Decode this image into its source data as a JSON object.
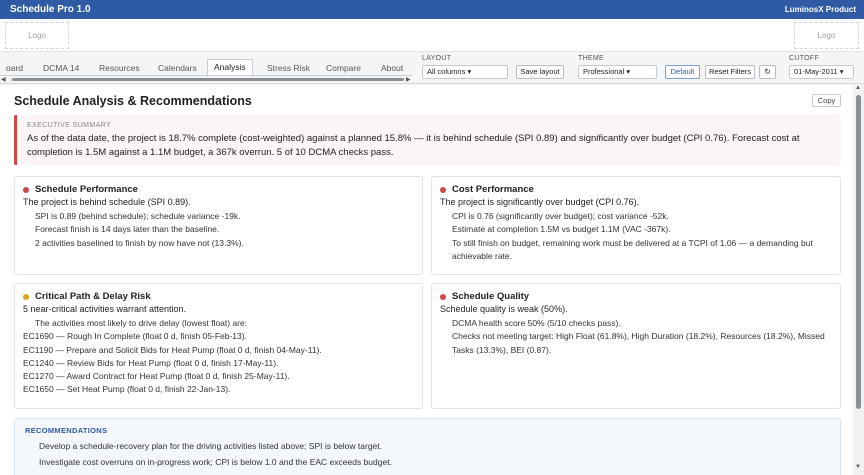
{
  "app": {
    "title": "Schedule Pro 1.0",
    "brand": "LuminosX Product"
  },
  "logos": {
    "left": "Logo",
    "right": "Logo"
  },
  "tabs": [
    {
      "label": "oard"
    },
    {
      "label": "DCMA 14"
    },
    {
      "label": "Resources"
    },
    {
      "label": "Calendars"
    },
    {
      "label": "Analysis",
      "active": true
    },
    {
      "label": "Stress Risk"
    },
    {
      "label": "Compare"
    },
    {
      "label": "About"
    }
  ],
  "controls": {
    "layout_label": "LAYOUT",
    "layout_value": "All columns",
    "save_layout": "Save layout",
    "theme_label": "THEME",
    "theme_value": "Professional",
    "default_btn": "Default",
    "reset_filters": "Reset Filters",
    "refresh_icon": "↻",
    "cutoff_label": "CUTOFF",
    "cutoff_value": "01-May-2011"
  },
  "page": {
    "title": "Schedule Analysis & Recommendations",
    "copy": "Copy"
  },
  "executive": {
    "label": "EXECUTIVE SUMMARY",
    "text": "As of the data date, the project is 18.7% complete (cost-weighted) against a planned 15.8% — it is behind schedule (SPI 0.89) and significantly over budget (CPI 0.76). Forecast cost at completion is 1.5M against a 1.1M budget, a 367k overrun. 5 of 10 DCMA checks pass."
  },
  "cards": {
    "schedule": {
      "title": "Schedule Performance",
      "color": "#c94a43",
      "summary": "The project is behind schedule (SPI 0.89).",
      "items": [
        "SPI is 0.89 (behind schedule); schedule variance -19k.",
        "Forecast finish is 14 days later than the baseline.",
        "2 activities baselined to finish by now have not (13.3%)."
      ]
    },
    "cost": {
      "title": "Cost Performance",
      "color": "#c94a43",
      "summary": "The project is significantly over budget (CPI 0.76).",
      "items": [
        "CPI is 0.76 (significantly over budget); cost variance -52k.",
        "Estimate at completion 1.5M vs budget 1.1M (VAC -367k).",
        "To still finish on budget, remaining work must be delivered at a TCPI of 1.06 — a demanding but achievable rate."
      ]
    },
    "critical": {
      "title": "Critical Path & Delay Risk",
      "color": "#e0a21b",
      "summary": "5 near-critical activities warrant attention.",
      "intro": "The activities most likely to drive delay (lowest float) are:",
      "items": [
        "EC1690 — Rough In Complete (float 0 d, finish 05-Feb-13).",
        "EC1190 — Prepare and Solicit Bids for Heat Pump (float 0 d, finish 04-May-11).",
        "EC1240 — Review Bids for Heat Pump (float 0 d, finish 17-May-11).",
        "EC1270 — Award Contract for Heat Pump (float 0 d, finish 25-May-11).",
        "EC1650 — Set Heat Pump (float 0 d, finish 22-Jan-13)."
      ]
    },
    "quality": {
      "title": "Schedule Quality",
      "color": "#c94a43",
      "summary": "Schedule quality is weak (50%).",
      "items": [
        "DCMA health score 50% (5/10 checks pass).",
        "Checks not meeting target: High Float (61.8%), High Duration (18.2%), Resources (18.2%), Missed Tasks (13.3%), BEI (0.87)."
      ]
    }
  },
  "recommendations": {
    "label": "RECOMMENDATIONS",
    "items": [
      "Develop a schedule-recovery plan for the driving activities listed above; SPI is below target.",
      "Investigate cost overruns on in-progress work; CPI is below 1.0 and the EAC exceeds budget."
    ]
  }
}
